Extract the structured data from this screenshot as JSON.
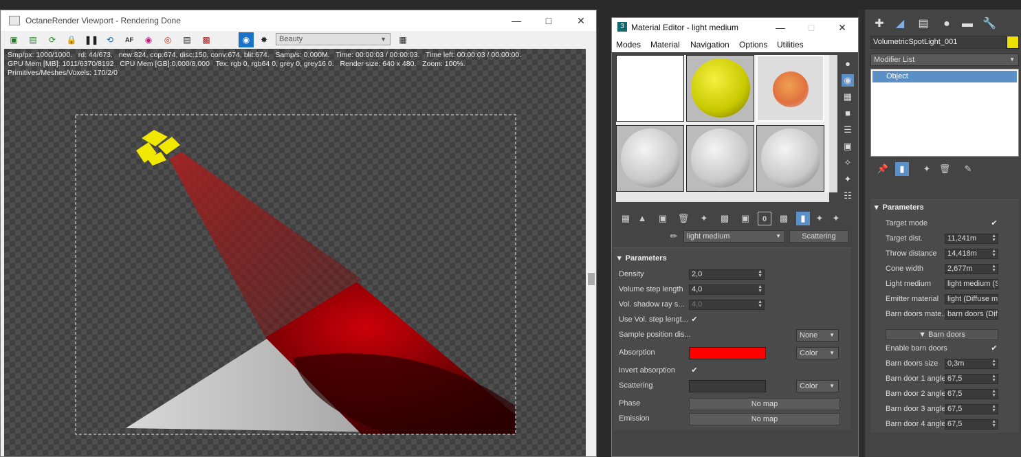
{
  "octane": {
    "title": "OctaneRender Viewport - Rendering Done",
    "render_pass": "Beauty",
    "stats_line1": "Smp/px: 1000/1000.   rd: 44/673.   new:824, cop:674, disc:150, conv:674, blit:674.   Samp/s: 0,000M.   Time: 00:00:03 / 00:00:03.   Time left: 00:00:03 / 00:00:00.",
    "stats_line2": "GPU Mem [MB]: 1011/6370/8192   CPU Mem [GB]:0,000/8,000   Tex: rgb 0, rgb64 0, grey 0, grey16 0.   Render size: 640 x 480.   Zoom: 100%.",
    "stats_line3": "Primitives/Meshes/Voxels: 170/2/0",
    "toolbar_icons": [
      "export-icon",
      "save-icon",
      "refresh-icon",
      "lock-icon",
      "pause-icon",
      "restart-icon",
      "af-icon",
      "color-icon",
      "region-icon",
      "film-icon",
      "cam-icon",
      "render-cam-icon",
      "settings-icon",
      "save-image-icon"
    ]
  },
  "material_editor": {
    "title": "Material Editor - light medium",
    "menus": [
      "Modes",
      "Material",
      "Navigation",
      "Options",
      "Utilities"
    ],
    "material_name": "light medium",
    "material_type": "Scattering",
    "section_title": "Parameters",
    "params": {
      "density_label": "Density",
      "density_value": "2,0",
      "step_label": "Volume step length",
      "step_value": "4,0",
      "shadow_label": "Vol. shadow ray s...",
      "shadow_value": "4,0",
      "use_step_label": "Use Vol. step lengt...",
      "sample_label": "Sample position dis...",
      "sample_value": "None",
      "absorption_label": "Absorption",
      "absorption_mode": "Color",
      "absorption_color": "#ff0000",
      "invert_label": "Invert absorption",
      "scattering_label": "Scattering",
      "scattering_mode": "Color",
      "scattering_color": "#3a3a3a",
      "phase_label": "Phase",
      "phase_value": "No map",
      "emission_label": "Emission",
      "emission_value": "No map"
    }
  },
  "command_panel": {
    "object_name": "VolumetricSpotLight_001",
    "object_color": "#f0e000",
    "modifier_list": "Modifier List",
    "stack_item": "Object",
    "section_title": "Parameters",
    "params": {
      "target_mode": "Target mode",
      "target_dist_label": "Target dist.",
      "target_dist_value": "11,241m",
      "throw_label": "Throw distance",
      "throw_value": "14,418m",
      "cone_label": "Cone width",
      "cone_value": "2,677m",
      "light_medium_label": "Light medium",
      "light_medium_value": "light medium (Sc",
      "emitter_label": "Emitter material",
      "emitter_value": "light (Diffuse ma",
      "barn_mat_label": "Barn doors mate...",
      "barn_mat_value": "barn doors (Diff",
      "barn_group": "Barn doors",
      "enable_barn": "Enable barn doors",
      "barn_size_label": "Barn doors size",
      "barn_size_value": "0,3m",
      "door1_label": "Barn door 1 angle",
      "door1_value": "67,5",
      "door2_label": "Barn door 2 angle",
      "door2_value": "67,5",
      "door3_label": "Barn door 3 angle",
      "door3_value": "67,5",
      "door4_label": "Barn door 4 angle",
      "door4_value": "67,5"
    }
  }
}
